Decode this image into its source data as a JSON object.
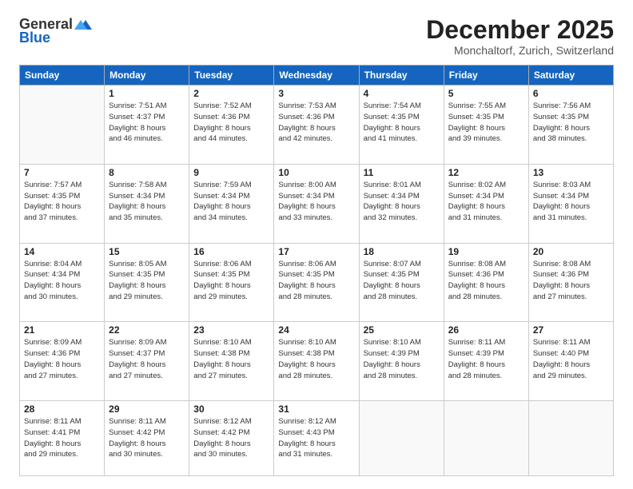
{
  "logo": {
    "general": "General",
    "blue": "Blue"
  },
  "header": {
    "month": "December 2025",
    "location": "Monchaltorf, Zurich, Switzerland"
  },
  "weekdays": [
    "Sunday",
    "Monday",
    "Tuesday",
    "Wednesday",
    "Thursday",
    "Friday",
    "Saturday"
  ],
  "weeks": [
    [
      {
        "day": "",
        "info": ""
      },
      {
        "day": "1",
        "info": "Sunrise: 7:51 AM\nSunset: 4:37 PM\nDaylight: 8 hours\nand 46 minutes."
      },
      {
        "day": "2",
        "info": "Sunrise: 7:52 AM\nSunset: 4:36 PM\nDaylight: 8 hours\nand 44 minutes."
      },
      {
        "day": "3",
        "info": "Sunrise: 7:53 AM\nSunset: 4:36 PM\nDaylight: 8 hours\nand 42 minutes."
      },
      {
        "day": "4",
        "info": "Sunrise: 7:54 AM\nSunset: 4:35 PM\nDaylight: 8 hours\nand 41 minutes."
      },
      {
        "day": "5",
        "info": "Sunrise: 7:55 AM\nSunset: 4:35 PM\nDaylight: 8 hours\nand 39 minutes."
      },
      {
        "day": "6",
        "info": "Sunrise: 7:56 AM\nSunset: 4:35 PM\nDaylight: 8 hours\nand 38 minutes."
      }
    ],
    [
      {
        "day": "7",
        "info": "Sunrise: 7:57 AM\nSunset: 4:35 PM\nDaylight: 8 hours\nand 37 minutes."
      },
      {
        "day": "8",
        "info": "Sunrise: 7:58 AM\nSunset: 4:34 PM\nDaylight: 8 hours\nand 35 minutes."
      },
      {
        "day": "9",
        "info": "Sunrise: 7:59 AM\nSunset: 4:34 PM\nDaylight: 8 hours\nand 34 minutes."
      },
      {
        "day": "10",
        "info": "Sunrise: 8:00 AM\nSunset: 4:34 PM\nDaylight: 8 hours\nand 33 minutes."
      },
      {
        "day": "11",
        "info": "Sunrise: 8:01 AM\nSunset: 4:34 PM\nDaylight: 8 hours\nand 32 minutes."
      },
      {
        "day": "12",
        "info": "Sunrise: 8:02 AM\nSunset: 4:34 PM\nDaylight: 8 hours\nand 31 minutes."
      },
      {
        "day": "13",
        "info": "Sunrise: 8:03 AM\nSunset: 4:34 PM\nDaylight: 8 hours\nand 31 minutes."
      }
    ],
    [
      {
        "day": "14",
        "info": "Sunrise: 8:04 AM\nSunset: 4:34 PM\nDaylight: 8 hours\nand 30 minutes."
      },
      {
        "day": "15",
        "info": "Sunrise: 8:05 AM\nSunset: 4:35 PM\nDaylight: 8 hours\nand 29 minutes."
      },
      {
        "day": "16",
        "info": "Sunrise: 8:06 AM\nSunset: 4:35 PM\nDaylight: 8 hours\nand 29 minutes."
      },
      {
        "day": "17",
        "info": "Sunrise: 8:06 AM\nSunset: 4:35 PM\nDaylight: 8 hours\nand 28 minutes."
      },
      {
        "day": "18",
        "info": "Sunrise: 8:07 AM\nSunset: 4:35 PM\nDaylight: 8 hours\nand 28 minutes."
      },
      {
        "day": "19",
        "info": "Sunrise: 8:08 AM\nSunset: 4:36 PM\nDaylight: 8 hours\nand 28 minutes."
      },
      {
        "day": "20",
        "info": "Sunrise: 8:08 AM\nSunset: 4:36 PM\nDaylight: 8 hours\nand 27 minutes."
      }
    ],
    [
      {
        "day": "21",
        "info": "Sunrise: 8:09 AM\nSunset: 4:36 PM\nDaylight: 8 hours\nand 27 minutes."
      },
      {
        "day": "22",
        "info": "Sunrise: 8:09 AM\nSunset: 4:37 PM\nDaylight: 8 hours\nand 27 minutes."
      },
      {
        "day": "23",
        "info": "Sunrise: 8:10 AM\nSunset: 4:38 PM\nDaylight: 8 hours\nand 27 minutes."
      },
      {
        "day": "24",
        "info": "Sunrise: 8:10 AM\nSunset: 4:38 PM\nDaylight: 8 hours\nand 28 minutes."
      },
      {
        "day": "25",
        "info": "Sunrise: 8:10 AM\nSunset: 4:39 PM\nDaylight: 8 hours\nand 28 minutes."
      },
      {
        "day": "26",
        "info": "Sunrise: 8:11 AM\nSunset: 4:39 PM\nDaylight: 8 hours\nand 28 minutes."
      },
      {
        "day": "27",
        "info": "Sunrise: 8:11 AM\nSunset: 4:40 PM\nDaylight: 8 hours\nand 29 minutes."
      }
    ],
    [
      {
        "day": "28",
        "info": "Sunrise: 8:11 AM\nSunset: 4:41 PM\nDaylight: 8 hours\nand 29 minutes."
      },
      {
        "day": "29",
        "info": "Sunrise: 8:11 AM\nSunset: 4:42 PM\nDaylight: 8 hours\nand 30 minutes."
      },
      {
        "day": "30",
        "info": "Sunrise: 8:12 AM\nSunset: 4:42 PM\nDaylight: 8 hours\nand 30 minutes."
      },
      {
        "day": "31",
        "info": "Sunrise: 8:12 AM\nSunset: 4:43 PM\nDaylight: 8 hours\nand 31 minutes."
      },
      {
        "day": "",
        "info": ""
      },
      {
        "day": "",
        "info": ""
      },
      {
        "day": "",
        "info": ""
      }
    ]
  ]
}
